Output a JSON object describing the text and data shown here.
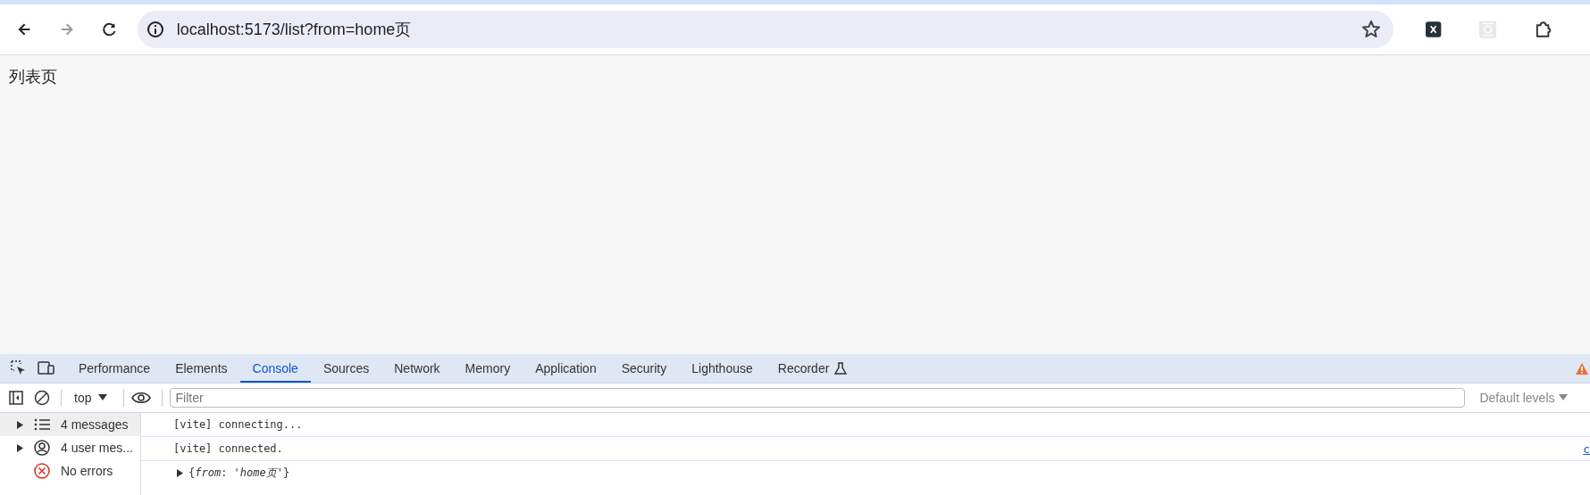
{
  "browser": {
    "back": {
      "disabled": false
    },
    "forward": {
      "disabled": true
    },
    "url": "localhost:5173/list?from=home页"
  },
  "page": {
    "heading": "列表页"
  },
  "devtools": {
    "tabs": [
      {
        "label": "Performance",
        "selected": false
      },
      {
        "label": "Elements",
        "selected": false
      },
      {
        "label": "Console",
        "selected": true
      },
      {
        "label": "Sources",
        "selected": false
      },
      {
        "label": "Network",
        "selected": false
      },
      {
        "label": "Memory",
        "selected": false
      },
      {
        "label": "Application",
        "selected": false
      },
      {
        "label": "Security",
        "selected": false
      },
      {
        "label": "Lighthouse",
        "selected": false
      },
      {
        "label": "Recorder",
        "selected": false,
        "kind": "experimental"
      }
    ],
    "toolbar": {
      "context": "top",
      "filter_placeholder": "Filter",
      "levels": "Default levels"
    },
    "sidebar": [
      {
        "kind": "messages",
        "label": "4 messages",
        "selected": true,
        "expandable": true
      },
      {
        "kind": "user",
        "label": "4 user mes...",
        "selected": false,
        "expandable": true
      },
      {
        "kind": "errors",
        "label": "No errors",
        "selected": false,
        "expandable": false
      }
    ],
    "messages": [
      {
        "kind": "text",
        "text": "[vite] connecting..."
      },
      {
        "kind": "text",
        "text": "[vite] connected.",
        "source": "c"
      },
      {
        "kind": "object",
        "text": "{*from*: *'home页'*}"
      }
    ]
  }
}
